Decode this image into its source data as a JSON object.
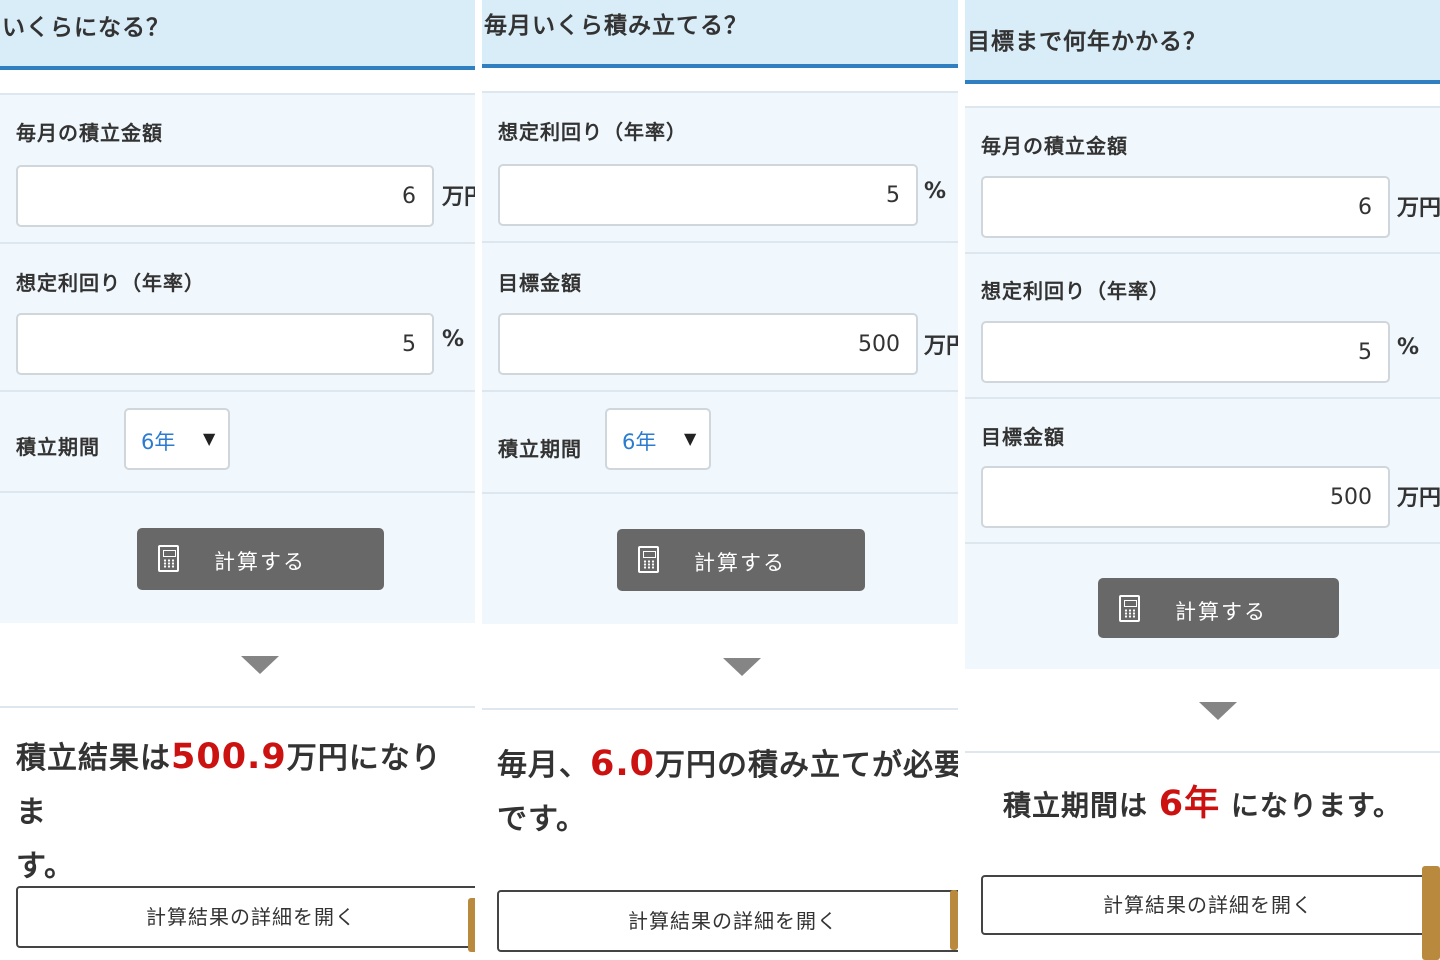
{
  "panel1": {
    "title": "いくらになる？",
    "field1_label": "毎月の積立金額",
    "field1_value": "6",
    "field1_unit": "万円",
    "field2_label": "想定利回り（年率）",
    "field2_value": "5",
    "field2_unit": "%",
    "period_label": "積立期間",
    "period_value": "6年",
    "calc_label": "計算する",
    "result_pre": "積立結果は",
    "result_num": "500.9",
    "result_post": "万円になりま",
    "result_line2": "す。",
    "detail_label": "計算結果の詳細を開く"
  },
  "panel2": {
    "title": "毎月いくら積み立てる？",
    "field1_label": "想定利回り（年率）",
    "field1_value": "5",
    "field1_unit": "%",
    "field2_label": "目標金額",
    "field2_value": "500",
    "field2_unit": "万円",
    "period_label": "積立期間",
    "period_value": "6年",
    "calc_label": "計算する",
    "result_pre": "毎月、",
    "result_num": "6.0",
    "result_post": "万円の積み立てが必要",
    "result_line2": "です。",
    "detail_label": "計算結果の詳細を開く"
  },
  "panel3": {
    "title": "目標まで何年かかる？",
    "field1_label": "毎月の積立金額",
    "field1_value": "6",
    "field1_unit": "万円",
    "field2_label": "想定利回り（年率）",
    "field2_value": "5",
    "field2_unit": "%",
    "field3_label": "目標金額",
    "field3_value": "500",
    "field3_unit": "万円",
    "calc_label": "計算する",
    "result_pre": "積立期間は ",
    "result_num": "6年",
    "result_post": " になります。",
    "detail_label": "計算結果の詳細を開く"
  },
  "colors": {
    "header_bg": "#d9edf9",
    "header_border": "#2f7fc1",
    "form_bg": "#f1f8fd",
    "button_bg": "#686868",
    "result_highlight": "#cc1111",
    "select_text": "#2a7bd1"
  }
}
